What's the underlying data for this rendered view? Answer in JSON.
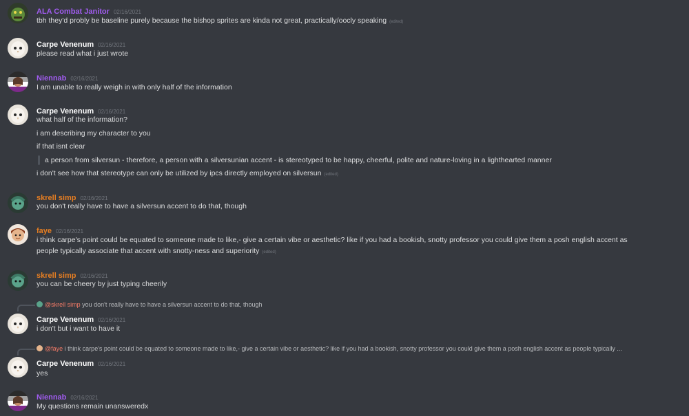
{
  "colors": {
    "background": "#36393f",
    "purple_name": "#a15cf0",
    "orange_name": "#e67e22",
    "white_name": "#ffffff",
    "timestamp": "#72767d"
  },
  "messages": [
    {
      "author": "ALA Combat Janitor",
      "timestamp": "02/16/2021",
      "avatar": "green-creature-avatar",
      "lines": [
        "tbh they'd probly be baseline purely because the bishop sprites are kinda not great, practically/oocly speaking"
      ],
      "edited": "(edited)"
    },
    {
      "author": "Carpe Venenum",
      "timestamp": "02/16/2021",
      "avatar": "barn-owl-avatar",
      "lines": [
        "please read what i just wrote"
      ]
    },
    {
      "author": "Niennab",
      "timestamp": "02/16/2021",
      "avatar": "pride-flag-avatar",
      "lines": [
        "I am unable to really weigh in with only half of the information"
      ]
    },
    {
      "author": "Carpe Venenum",
      "timestamp": "02/16/2021",
      "avatar": "barn-owl-avatar",
      "lines": [
        "what half of the information?",
        "i am describing my character to you",
        "if that isnt clear"
      ],
      "quote": "a person from silversun - therefore, a person with a silversunian accent - is stereotyped to be happy, cheerful, polite and nature-loving in a lighthearted manner",
      "after_quote": "i don't see how that stereotype can only be utilized by ipcs directly employed on silversun",
      "edited": "(edited)"
    },
    {
      "author": "skrell simp",
      "timestamp": "02/16/2021",
      "avatar": "skrell-avatar",
      "lines": [
        "you don't really have to have a silversun accent to do that, though"
      ]
    },
    {
      "author": "faye",
      "timestamp": "02/16/2021",
      "avatar": "faye-avatar",
      "lines": [
        "i think carpe's point could be equated to someone made to like,- give a certain vibe or aesthetic? like if you had a bookish, snotty professor you could give them a posh english accent as",
        "people typically associate that accent with snotty-ness and superiority"
      ],
      "edited": "(edited)"
    },
    {
      "author": "skrell simp",
      "timestamp": "02/16/2021",
      "avatar": "skrell-avatar",
      "lines": [
        "you can be cheery by just typing cheerily"
      ]
    },
    {
      "reply_mention": "@skrell simp",
      "reply_text": "you don't really have to have a silversun accent to do that, though",
      "author": "Carpe Venenum",
      "timestamp": "02/16/2021",
      "avatar": "barn-owl-avatar",
      "lines": [
        "i don't but i want to have it"
      ]
    },
    {
      "reply_mention": "@faye",
      "reply_text": "i think carpe's point could be equated to someone made to like,- give a certain vibe or aesthetic? like if you had a bookish, snotty professor you could give them a posh english accent as people typically ...",
      "author": "Carpe Venenum",
      "timestamp": "02/16/2021",
      "avatar": "barn-owl-avatar",
      "lines": [
        "yes"
      ]
    },
    {
      "author": "Niennab",
      "timestamp": "02/16/2021",
      "avatar": "pride-flag-avatar",
      "lines": [
        "My questions remain unansweredx"
      ]
    }
  ]
}
